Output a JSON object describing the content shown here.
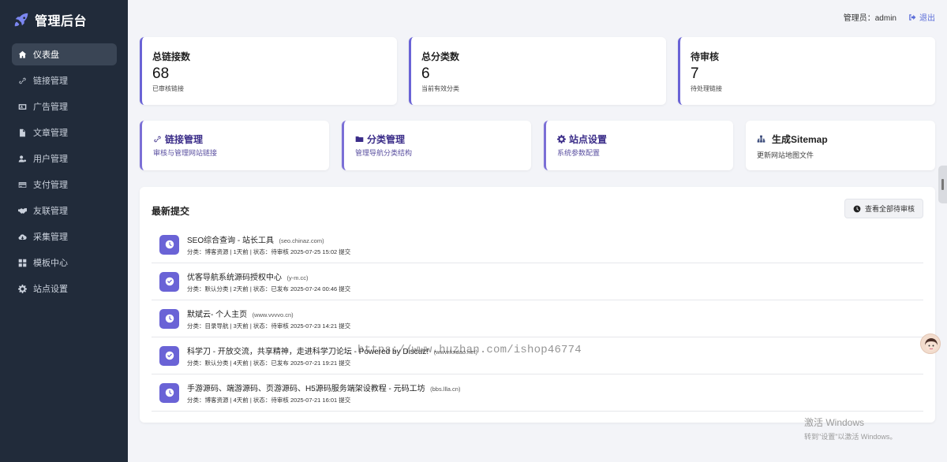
{
  "app": {
    "title": "管理后台"
  },
  "sidebar": {
    "items": [
      {
        "label": "仪表盘",
        "icon": "dashboard-icon",
        "active": true
      },
      {
        "label": "链接管理",
        "icon": "link-icon"
      },
      {
        "label": "广告管理",
        "icon": "ad-icon"
      },
      {
        "label": "文章管理",
        "icon": "file-icon"
      },
      {
        "label": "用户管理",
        "icon": "user-gear-icon"
      },
      {
        "label": "支付管理",
        "icon": "credit-card-icon"
      },
      {
        "label": "友联管理",
        "icon": "handshake-icon"
      },
      {
        "label": "采集管理",
        "icon": "cloud-download-icon"
      },
      {
        "label": "模板中心",
        "icon": "grid-icon"
      },
      {
        "label": "站点设置",
        "icon": "gear-icon"
      }
    ]
  },
  "header": {
    "admin_label": "管理员：admin",
    "logout_label": "退出"
  },
  "stats": [
    {
      "title": "总链接数",
      "value": "68",
      "sub": "已审核链接"
    },
    {
      "title": "总分类数",
      "value": "6",
      "sub": "当前有效分类"
    },
    {
      "title": "待审核",
      "value": "7",
      "sub": "待处理链接"
    }
  ],
  "quick_links": [
    {
      "title": "链接管理",
      "sub": "审核与管理网站链接",
      "icon": "link-icon"
    },
    {
      "title": "分类管理",
      "sub": "管理导航分类结构",
      "icon": "folder-icon"
    },
    {
      "title": "站点设置",
      "sub": "系统参数配置",
      "icon": "gear-icon"
    },
    {
      "title": "生成Sitemap",
      "sub": "更新网站地图文件",
      "icon": "sitemap-icon"
    }
  ],
  "recent": {
    "title": "最新提交",
    "view_all_label": "查看全部待审核",
    "items": [
      {
        "name": "SEO综合查询 - 站长工具",
        "domain": "(seo.chinaz.com)",
        "meta": "分类：博客资源 | 1天前 | 状态：待审核 2025-07-25 15:02 提交",
        "status": "pending"
      },
      {
        "name": "优客导航系统源码授权中心",
        "domain": "(y-m.cc)",
        "meta": "分类：默认分类 | 2天前 | 状态：已发布 2025-07-24 00:46 提交",
        "status": "published"
      },
      {
        "name": "默斌云- 个人主页",
        "domain": "(www.vvvvo.cn)",
        "meta": "分类：目录导航 | 3天前 | 状态：待审核 2025-07-23 14:21 提交",
        "status": "pending"
      },
      {
        "name": "科学刀 - 开放交流，共享精神，走进科学刀论坛 - Powered by Discuz!",
        "domain": "(www.kxdao.net)",
        "meta": "分类：默认分类 | 4天前 | 状态：已发布 2025-07-21 19:21 提交",
        "status": "published"
      },
      {
        "name": "手游源码、端游源码、页游源码、H5源码服务端架设教程 - 元码工坊",
        "domain": "(bbs.llla.cn)",
        "meta": "分类：博客资源 | 4天前 | 状态：待审核 2025-07-21 16:01 提交",
        "status": "pending"
      }
    ]
  },
  "overlay": {
    "watermark": "https://www.huzhan.com/ishop46774",
    "windows_activate_line1": "激活 Windows",
    "windows_activate_line2": "转到\"设置\"以激活 Windows。"
  },
  "colors": {
    "accent": "#6a63d6",
    "sidebar_bg": "#212b3a",
    "page_bg": "#f3f4f8",
    "link_blue": "#5b6dd8"
  }
}
